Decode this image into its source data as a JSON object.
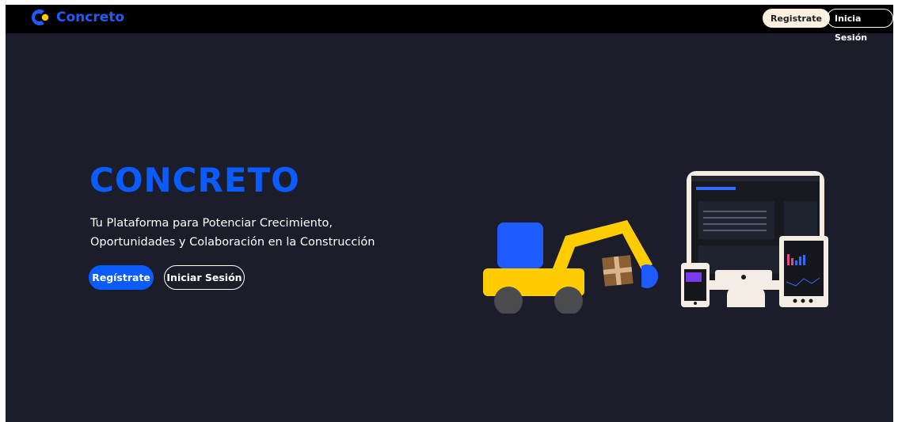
{
  "navbar": {
    "brand": "Concreto",
    "register_label": "Registrate",
    "login_label": "Inicia Sesión"
  },
  "hero": {
    "title": "CONCRETO",
    "subtitle_line1": "Tu Plataforma para Potenciar Crecimiento,",
    "subtitle_line2": "Oportunidades y Colaboración en la Construcción",
    "register_label": "Regístrate",
    "login_label": "Iniciar Sesión"
  },
  "colors": {
    "accent": "#0b5cff",
    "background": "#1b1d2b",
    "navbar": "#000000",
    "excavator_yellow": "#ffcc00",
    "button_cream": "#fdf0dc"
  },
  "icons": {
    "logo": "concreto-logo-icon",
    "illustration": "excavator-devices-illustration"
  }
}
